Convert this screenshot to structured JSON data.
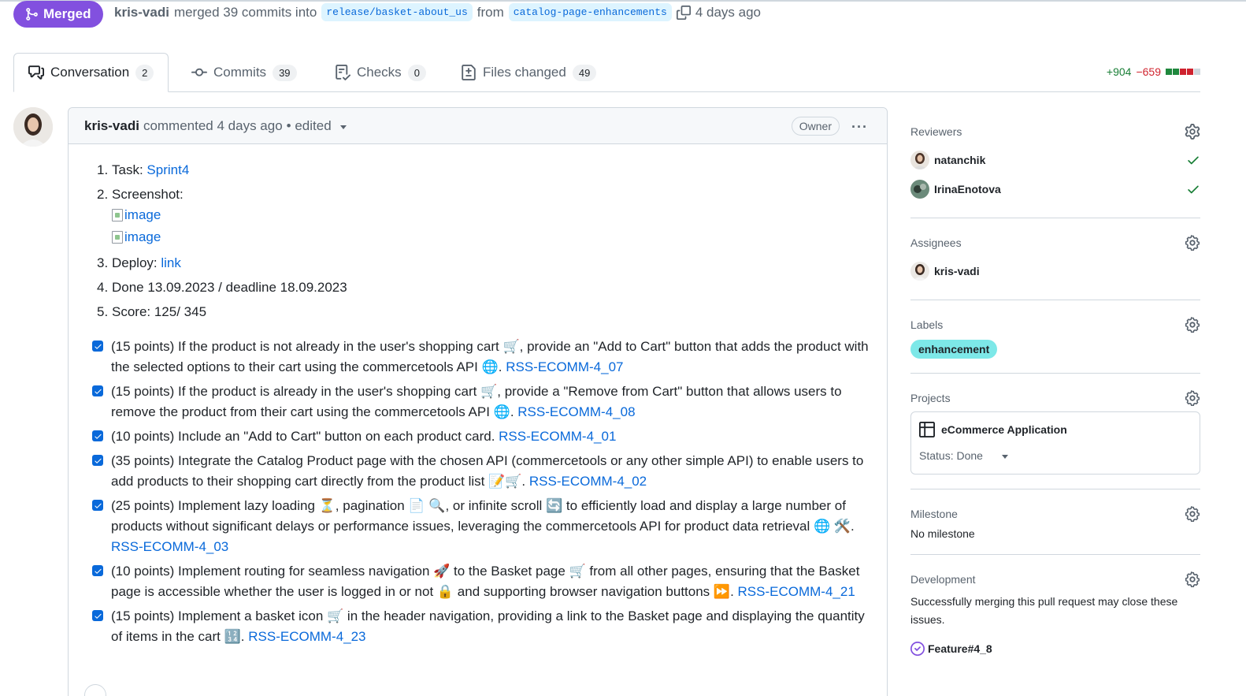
{
  "header": {
    "status_label": "Merged",
    "author": "kris-vadi",
    "merged_text": "merged 39 commits into",
    "base_branch": "release/basket-about_us",
    "from_text": "from",
    "head_branch": "catalog-page-enhancements",
    "time": "4 days ago"
  },
  "tabs": [
    {
      "label": "Conversation",
      "count": "2",
      "icon": "comment-discussion-icon"
    },
    {
      "label": "Commits",
      "count": "39",
      "icon": "git-commit-icon"
    },
    {
      "label": "Checks",
      "count": "0",
      "icon": "checklist-icon"
    },
    {
      "label": "Files changed",
      "count": "49",
      "icon": "file-diff-icon"
    }
  ],
  "diffstat": {
    "additions": "+904",
    "deletions": "−659"
  },
  "comment": {
    "author": "kris-vadi",
    "action": "commented 4 days ago",
    "edited": "• edited",
    "role": "Owner",
    "items": [
      {
        "num": "1.",
        "label": "Task:",
        "link": "Sprint4"
      },
      {
        "num": "2.",
        "label": "Screenshot:",
        "images": [
          "image",
          "image"
        ]
      },
      {
        "num": "3.",
        "label": "Deploy:",
        "link": "link"
      },
      {
        "num": "4.",
        "label": "Done 13.09.2023 / deadline 18.09.2023"
      },
      {
        "num": "5.",
        "label": "Score: 125/ 345"
      }
    ],
    "tasks": [
      {
        "text": "(15 points) If the product is not already in the user's shopping cart 🛒, provide an \"Add to Cart\" button that adds the product with the selected options to their cart using the commercetools API 🌐.",
        "link": "RSS-ECOMM-4_07"
      },
      {
        "text": "(15 points) If the product is already in the user's shopping cart 🛒, provide a \"Remove from Cart\" button that allows users to remove the product from their cart using the commercetools API 🌐.",
        "link": "RSS-ECOMM-4_08"
      },
      {
        "text": "(10 points) Include an \"Add to Cart\" button on each product card.",
        "link": "RSS-ECOMM-4_01"
      },
      {
        "text": "(35 points) Integrate the Catalog Product page with the chosen API (commercetools or any other simple API) to enable users to add products to their shopping cart directly from the product list 📝🛒.",
        "link": "RSS-ECOMM-4_02"
      },
      {
        "text": "(25 points) Implement lazy loading ⏳, pagination 📄 🔍, or infinite scroll 🔄 to efficiently load and display a large number of products without significant delays or performance issues, leveraging the commercetools API for product data retrieval 🌐 🛠️.",
        "link": "RSS-ECOMM-4_03"
      },
      {
        "text": "(10 points) Implement routing for seamless navigation 🚀 to the Basket page 🛒 from all other pages, ensuring that the Basket page is accessible whether the user is logged in or not 🔒 and supporting browser navigation buttons ⏩.",
        "link": "RSS-ECOMM-4_21"
      },
      {
        "text": "(15 points) Implement a basket icon 🛒 in the header navigation, providing a link to the Basket page and displaying the quantity of items in the cart 🔢.",
        "link": "RSS-ECOMM-4_23"
      }
    ]
  },
  "sidebar": {
    "reviewers": {
      "title": "Reviewers",
      "people": [
        "natanchik",
        "IrinaEnotova"
      ]
    },
    "assignees": {
      "title": "Assignees",
      "people": [
        "kris-vadi"
      ]
    },
    "labels": {
      "title": "Labels",
      "items": [
        "enhancement"
      ]
    },
    "projects": {
      "title": "Projects",
      "name": "eCommerce Application",
      "status": "Status: Done"
    },
    "milestone": {
      "title": "Milestone",
      "value": "No milestone"
    },
    "development": {
      "title": "Development",
      "text": "Successfully merging this pull request may close these issues.",
      "issues": [
        "Feature#4_8"
      ]
    }
  },
  "colors": {
    "merged": "#8250df",
    "link": "#0969da",
    "label_bg": "#7de8e8",
    "addition": "#1a7f37",
    "deletion": "#d1242f"
  }
}
